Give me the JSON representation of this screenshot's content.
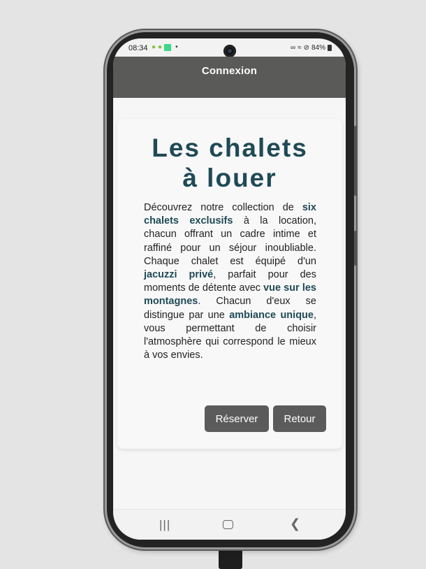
{
  "status_bar": {
    "time": "08:34",
    "right_text": "84%"
  },
  "app_bar": {
    "title": "Connexion"
  },
  "card": {
    "title_line1": "Les chalets",
    "title_line2": "à louer",
    "description": {
      "p1": "Découvrez notre collection de ",
      "b1": "six chalets exclusifs",
      "p2": " à la location, chacun offrant un cadre intime et raffiné pour un séjour inoubliable. Chaque chalet est équipé d'un ",
      "b2": "jacuzzi privé",
      "p3": ", parfait pour des moments de détente avec ",
      "b3": "vue sur les montagnes",
      "p4": ". Chacun d'eux se distingue par une ",
      "b4": "ambiance unique",
      "p5": ", vous permettant de choisir l'atmosphère qui correspond le mieux à vos envies."
    },
    "buttons": {
      "reserve": "Réserver",
      "back": "Retour"
    }
  },
  "nav_bar": {
    "recent_icon": "recent-apps-icon",
    "home_icon": "home-icon",
    "back_icon": "back-chevron-icon"
  },
  "colors": {
    "app_bar_bg": "#5a5a58",
    "title_color": "#1f4a56",
    "button_bg": "#5b5b5b"
  }
}
